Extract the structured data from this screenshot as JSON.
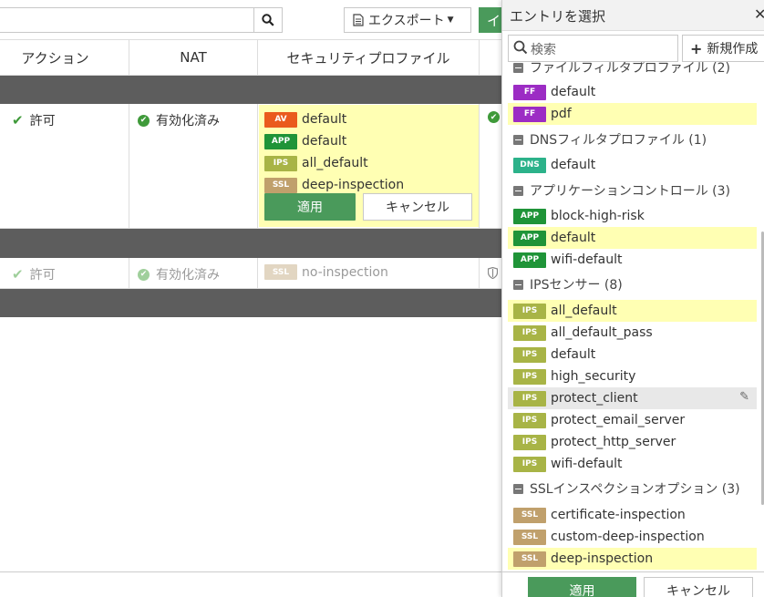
{
  "toolbar": {
    "search_value": "",
    "export_label": "エクスポート",
    "green_button_label": "イ"
  },
  "table": {
    "headers": [
      "アクション",
      "NAT",
      "セキュリティプロファイル"
    ],
    "rows": [
      {
        "action": "許可",
        "nat": "有効化済み",
        "profiles": [
          {
            "badge": "AV",
            "name": "default"
          },
          {
            "badge": "APP",
            "name": "default"
          },
          {
            "badge": "IPS",
            "name": "all_default"
          },
          {
            "badge": "SSL",
            "name": "deep-inspection"
          }
        ]
      },
      {
        "action": "許可",
        "nat": "有効化済み",
        "profiles": [
          {
            "badge": "SSL",
            "name": "no-inspection"
          }
        ]
      }
    ],
    "apply_label": "適用",
    "cancel_label": "キャンセル"
  },
  "panel": {
    "title": "エントリを選択",
    "search_placeholder": "検索",
    "new_label": "新規作成",
    "groups": [
      {
        "title": "ファイルフィルタプロファイル (2)",
        "entries": [
          {
            "badge": "FF",
            "name": "default",
            "selected": false
          },
          {
            "badge": "FF",
            "name": "pdf",
            "selected": true
          }
        ]
      },
      {
        "title": "DNSフィルタプロファイル (1)",
        "entries": [
          {
            "badge": "DNS",
            "name": "default",
            "selected": false
          }
        ]
      },
      {
        "title": "アプリケーションコントロール (3)",
        "entries": [
          {
            "badge": "APP",
            "name": "block-high-risk",
            "selected": false
          },
          {
            "badge": "APP",
            "name": "default",
            "selected": true
          },
          {
            "badge": "APP",
            "name": "wifi-default",
            "selected": false
          }
        ]
      },
      {
        "title": "IPSセンサー (8)",
        "entries": [
          {
            "badge": "IPS",
            "name": "all_default",
            "selected": true
          },
          {
            "badge": "IPS",
            "name": "all_default_pass",
            "selected": false
          },
          {
            "badge": "IPS",
            "name": "default",
            "selected": false
          },
          {
            "badge": "IPS",
            "name": "high_security",
            "selected": false
          },
          {
            "badge": "IPS",
            "name": "protect_client",
            "selected": false,
            "hovered": true
          },
          {
            "badge": "IPS",
            "name": "protect_email_server",
            "selected": false
          },
          {
            "badge": "IPS",
            "name": "protect_http_server",
            "selected": false
          },
          {
            "badge": "IPS",
            "name": "wifi-default",
            "selected": false
          }
        ]
      },
      {
        "title": "SSLインスペクションオプション (3)",
        "entries": [
          {
            "badge": "SSL",
            "name": "certificate-inspection",
            "selected": false
          },
          {
            "badge": "SSL",
            "name": "custom-deep-inspection",
            "selected": false
          },
          {
            "badge": "SSL",
            "name": "deep-inspection",
            "selected": true
          }
        ]
      }
    ],
    "apply_label": "適用",
    "cancel_label": "キャンセル"
  },
  "colors": {
    "accent_green": "#4a9a5b",
    "selected_row": "#ffffb3",
    "badge_av": "#ea5a1d",
    "badge_app": "#1f9438",
    "badge_ips": "#a8b446",
    "badge_ssl": "#c0a06c",
    "badge_ff": "#9c2cc4",
    "badge_dns": "#2cb28a"
  }
}
